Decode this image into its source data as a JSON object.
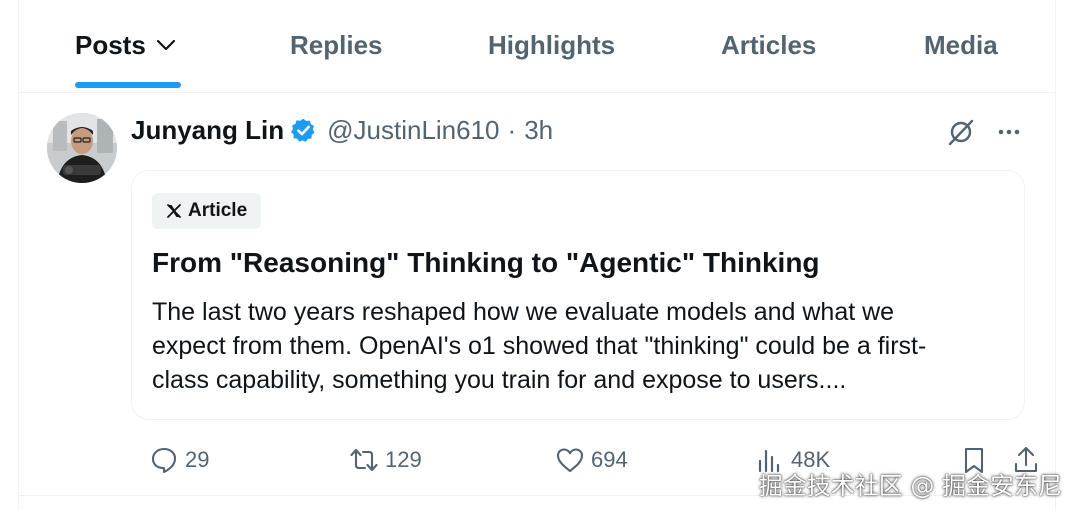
{
  "tabs": [
    {
      "label": "Posts",
      "active": true,
      "has_dropdown": true
    },
    {
      "label": "Replies"
    },
    {
      "label": "Highlights"
    },
    {
      "label": "Articles"
    },
    {
      "label": "Media"
    }
  ],
  "post": {
    "author": {
      "display_name": "Junyang Lin",
      "verified": true,
      "handle": "@JustinLin610"
    },
    "separator": "·",
    "time": "3h",
    "top_icons": [
      "grok-analyze-icon",
      "more-options-icon"
    ],
    "article": {
      "badge_label": "Article",
      "badge_icon": "x-logo-icon",
      "title": "From \"Reasoning\" Thinking to \"Agentic\" Thinking",
      "excerpt_lines": [
        "The last two years reshaped how we evaluate models and what we",
        "expect from them. OpenAI's o1 showed that \"thinking\" could be a first-",
        "class capability, something you train for and expose to users...."
      ]
    },
    "stats": {
      "replies": "29",
      "reposts": "129",
      "likes": "694",
      "views": "48K"
    }
  },
  "colors": {
    "accent": "#1d9bf0",
    "text_primary": "#0f1419",
    "text_secondary": "#536471",
    "border": "#eff3f4"
  },
  "watermark": "掘金技术社区 @ 掘金安东尼"
}
